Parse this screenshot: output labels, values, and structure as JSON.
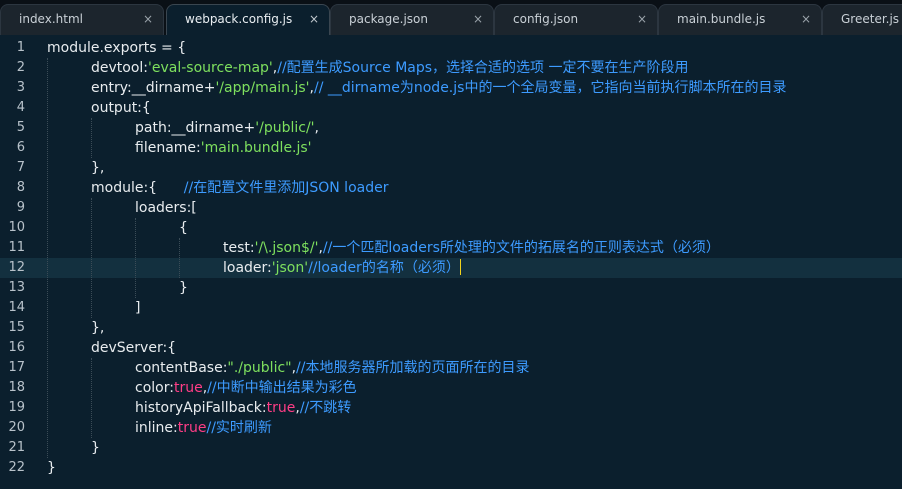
{
  "tabs": [
    {
      "label": "index.html",
      "close": "×",
      "active": false
    },
    {
      "label": "webpack.config.js",
      "close": "×",
      "active": true
    },
    {
      "label": "package.json",
      "close": "×",
      "active": false
    },
    {
      "label": "config.json",
      "close": "×",
      "active": false
    },
    {
      "label": "main.bundle.js",
      "close": "×",
      "active": false
    },
    {
      "label": "Greeter.js",
      "close": "",
      "active": false
    }
  ],
  "current_line": 12,
  "colors": {
    "keyword": "#e8ecef",
    "string": "#7ee05e",
    "comment": "#3d9bff",
    "boolean": "#ff3d86",
    "caret": "#f2d21c"
  },
  "lines": [
    {
      "n": "1",
      "indent": 0,
      "tokens": [
        {
          "t": "module.exports = {",
          "k": "key"
        }
      ]
    },
    {
      "n": "2",
      "indent": 1,
      "tokens": [
        {
          "t": "devtool:",
          "k": "key"
        },
        {
          "t": "'eval-source-map'",
          "k": "str"
        },
        {
          "t": ",",
          "k": "punc"
        },
        {
          "t": "//配置生成Source Maps，选择合适的选项 一定不要在生产阶段用",
          "k": "cmt"
        }
      ]
    },
    {
      "n": "3",
      "indent": 1,
      "tokens": [
        {
          "t": "entry:__dirname+",
          "k": "key"
        },
        {
          "t": "'/app/main.js'",
          "k": "str"
        },
        {
          "t": ",",
          "k": "punc"
        },
        {
          "t": "// __dirname为node.js中的一个全局变量，它指向当前执行脚本所在的目录",
          "k": "cmt"
        }
      ]
    },
    {
      "n": "4",
      "indent": 1,
      "tokens": [
        {
          "t": "output:{",
          "k": "key"
        }
      ]
    },
    {
      "n": "5",
      "indent": 2,
      "tokens": [
        {
          "t": "path:__dirname+",
          "k": "key"
        },
        {
          "t": "'/public/'",
          "k": "str"
        },
        {
          "t": ",",
          "k": "punc"
        }
      ]
    },
    {
      "n": "6",
      "indent": 2,
      "tokens": [
        {
          "t": "filename:",
          "k": "key"
        },
        {
          "t": "'main.bundle.js'",
          "k": "str"
        }
      ]
    },
    {
      "n": "7",
      "indent": 1,
      "tokens": [
        {
          "t": "},",
          "k": "key"
        }
      ]
    },
    {
      "n": "8",
      "indent": 1,
      "tokens": [
        {
          "t": "module:{",
          "k": "key"
        },
        {
          "t": "      //在配置文件里添加JSON loader",
          "k": "cmt"
        }
      ]
    },
    {
      "n": "9",
      "indent": 2,
      "tokens": [
        {
          "t": "loaders:[",
          "k": "key"
        }
      ]
    },
    {
      "n": "10",
      "indent": 3,
      "tokens": [
        {
          "t": "{",
          "k": "key"
        }
      ]
    },
    {
      "n": "11",
      "indent": 4,
      "tokens": [
        {
          "t": "test:",
          "k": "key"
        },
        {
          "t": "'/\\.json$/'",
          "k": "str"
        },
        {
          "t": ",",
          "k": "punc"
        },
        {
          "t": "//一个匹配loaders所处理的文件的拓展名的正则表达式（必须）",
          "k": "cmt"
        }
      ]
    },
    {
      "n": "12",
      "indent": 4,
      "tokens": [
        {
          "t": "loader:",
          "k": "key"
        },
        {
          "t": "'json'",
          "k": "str"
        },
        {
          "t": "//loader的名称（必须）",
          "k": "cmt"
        }
      ],
      "caret": true
    },
    {
      "n": "13",
      "indent": 3,
      "tokens": [
        {
          "t": "}",
          "k": "key"
        }
      ]
    },
    {
      "n": "14",
      "indent": 2,
      "tokens": [
        {
          "t": "]",
          "k": "key"
        }
      ]
    },
    {
      "n": "15",
      "indent": 1,
      "tokens": [
        {
          "t": "},",
          "k": "key"
        }
      ]
    },
    {
      "n": "16",
      "indent": 1,
      "tokens": [
        {
          "t": "devServer:{",
          "k": "key"
        }
      ]
    },
    {
      "n": "17",
      "indent": 2,
      "tokens": [
        {
          "t": "contentBase:",
          "k": "key"
        },
        {
          "t": "\"./public\"",
          "k": "str"
        },
        {
          "t": ",",
          "k": "punc"
        },
        {
          "t": "//本地服务器所加载的页面所在的目录",
          "k": "cmt"
        }
      ]
    },
    {
      "n": "18",
      "indent": 2,
      "tokens": [
        {
          "t": "color:",
          "k": "key"
        },
        {
          "t": "true",
          "k": "bool"
        },
        {
          "t": ",",
          "k": "punc"
        },
        {
          "t": "//中断中输出结果为彩色",
          "k": "cmt"
        }
      ]
    },
    {
      "n": "19",
      "indent": 2,
      "tokens": [
        {
          "t": "historyApiFallback:",
          "k": "key"
        },
        {
          "t": "true",
          "k": "bool"
        },
        {
          "t": ",",
          "k": "punc"
        },
        {
          "t": "//不跳转",
          "k": "cmt"
        }
      ]
    },
    {
      "n": "20",
      "indent": 2,
      "tokens": [
        {
          "t": "inline:",
          "k": "key"
        },
        {
          "t": "true",
          "k": "bool"
        },
        {
          "t": "//实时刷新",
          "k": "cmt"
        }
      ]
    },
    {
      "n": "21",
      "indent": 1,
      "tokens": [
        {
          "t": "}",
          "k": "key"
        }
      ]
    },
    {
      "n": "22",
      "indent": 0,
      "tokens": [
        {
          "t": "}",
          "k": "key"
        }
      ]
    }
  ]
}
